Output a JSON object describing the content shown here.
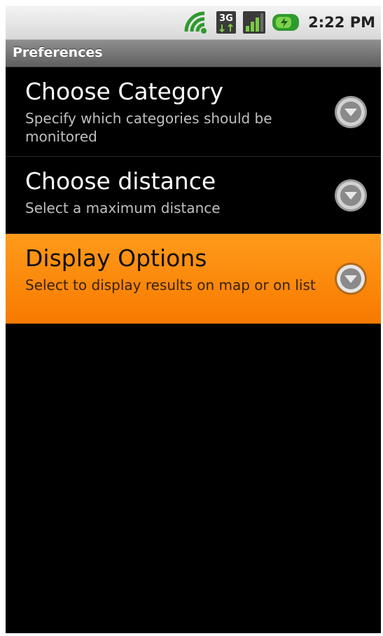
{
  "status_bar": {
    "time": "2:22 PM",
    "icons": [
      "wifi-icon",
      "3g-data-icon",
      "signal-strength-icon",
      "battery-charging-icon"
    ]
  },
  "title_bar": {
    "title": "Preferences"
  },
  "preferences": [
    {
      "title": "Choose Category",
      "summary": "Specify which categories should be monitored",
      "icon": "dropdown-arrow-icon",
      "selected": false
    },
    {
      "title": "Choose distance",
      "summary": "Select a maximum distance",
      "icon": "dropdown-arrow-icon",
      "selected": false
    },
    {
      "title": "Display Options",
      "summary": "Select to display results on map or on list",
      "icon": "dropdown-arrow-icon",
      "selected": true
    }
  ],
  "colors": {
    "background": "#000000",
    "highlight": "#ff8c00",
    "title_bar": "#777777",
    "status_bar": "#e6e6e6"
  }
}
